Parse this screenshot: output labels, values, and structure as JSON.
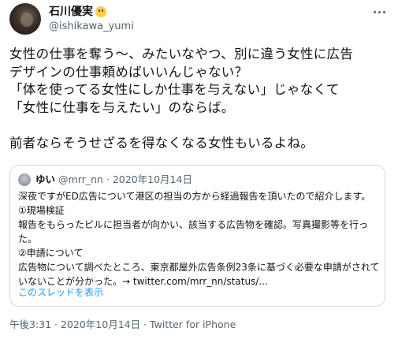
{
  "author": {
    "display_name": "石川優実",
    "name_emoji": "face-emoji",
    "handle": "@ishikawa_yumi"
  },
  "tweet": {
    "lines": [
      "女性の仕事を奪う〜、みたいなやつ、別に違う女性に広告",
      "デザインの仕事頼めばいいんじゃない？",
      "「体を使ってる女性にしか仕事を与えない」じゃなくて",
      "「女性に仕事を与えたい」のならば。",
      "",
      "前者ならそうせざるを得なくなる女性もいるよね。"
    ]
  },
  "quoted": {
    "display_name": "ゆい",
    "handle": "@mrr_nn",
    "separator": "·",
    "date": "2020年10月14日",
    "lines": [
      "深夜ですがED広告について港区の担当の方から経過報告を頂いたので紹介します。",
      "①現場検証",
      "報告をもらったビルに担当者が向かい、該当する広告物を確認。写真撮影等を行っ",
      "た。",
      "②申請について",
      "広告物について調べたところ、東京都屋外広告条例23条に基づく必要な申請がされて",
      "いないことが分かった。→ twitter.com/mrr_nn/status/..."
    ],
    "show_thread": "このスレッドを表示"
  },
  "meta": {
    "time": "午後3:31",
    "separator1": " · ",
    "date": "2020年10月14日",
    "separator2": " · ",
    "source": "Twitter for iPhone"
  },
  "colors": {
    "text": "#0f1419",
    "secondary": "#536471",
    "link": "#1d9bf0",
    "border": "#cfd9de"
  }
}
